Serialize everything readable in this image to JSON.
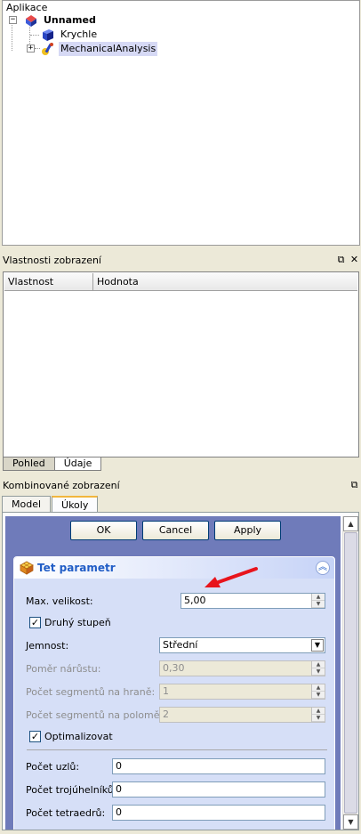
{
  "tree": {
    "header": "Aplikace",
    "root": "Unnamed",
    "children": [
      "Krychle",
      "MechanicalAnalysis"
    ]
  },
  "property_view": {
    "title": "Vlastnosti zobrazení",
    "columns": [
      "Vlastnost",
      "Hodnota"
    ],
    "tabs": [
      "Pohled",
      "Údaje"
    ],
    "active_tab": "Údaje"
  },
  "combo_view": {
    "title": "Kombinované zobrazení",
    "tabs": [
      "Model",
      "Úkoly"
    ],
    "active_tab": "Úkoly",
    "buttons": {
      "ok": "OK",
      "cancel": "Cancel",
      "apply": "Apply"
    },
    "panel": {
      "title": "Tet parametr",
      "max_size_label": "Max. velikost:",
      "max_size_value": "5,00",
      "second_order_label": "Druhý stupeň",
      "second_order_checked": true,
      "fineness_label": "Jemnost:",
      "fineness_value": "Střední",
      "growth_rate_label": "Poměr nárůstu:",
      "growth_rate_value": "0,30",
      "segments_edge_label": "Počet segmentů na hraně:",
      "segments_edge_value": "1",
      "segments_radius_label": "Počet segmentů na poloměru:",
      "segments_radius_value": "2",
      "optimize_label": "Optimalizovat",
      "optimize_checked": true,
      "nodes_label": "Počet uzlů:",
      "nodes_value": "0",
      "triangles_label": "Počet trojúhelníků:",
      "triangles_value": "0",
      "tetrahedra_label": "Počet tetraedrů:",
      "tetrahedra_value": "0"
    }
  },
  "colors": {
    "task_background": "#6f7bba",
    "panel_title": "#215dc6",
    "selection": "#d6d9f5",
    "annotation_arrow": "#e8141c"
  }
}
